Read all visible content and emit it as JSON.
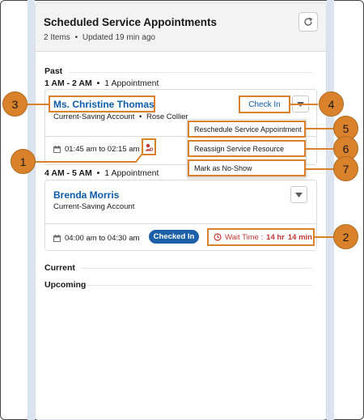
{
  "header": {
    "title": "Scheduled Service Appointments",
    "item_count": "2 Items",
    "separator": "•",
    "updated": "Updated 19 min ago"
  },
  "sections": {
    "past": "Past",
    "current": "Current",
    "upcoming": "Upcoming"
  },
  "slots": [
    {
      "range": "1 AM - 2 AM",
      "bullet": "•",
      "count": "1 Appointment",
      "appointment": {
        "customer": "Ms. Christine Thomas",
        "account": "Current-Saving Account",
        "bullet": "•",
        "resource": "Rose Collier",
        "time": "01:45 am to 02:15 am",
        "action": "Check In"
      }
    },
    {
      "range": "4 AM - 5 AM",
      "bullet": "•",
      "count": "1 Appointment",
      "appointment": {
        "customer": "Brenda Morris",
        "account": "Current-Saving Account",
        "time": "04:00 am to 04:30 am",
        "status": "Checked In",
        "wait_label": "Wait Time :",
        "wait_hours": "14 hr",
        "wait_minutes": "14 min"
      }
    }
  ],
  "menu": {
    "items": [
      "Reschedule Service Appointment",
      "Reassign Service Resource",
      "Mark as No-Show"
    ]
  },
  "callouts": [
    "1",
    "2",
    "3",
    "4",
    "5",
    "6",
    "7"
  ],
  "icons": {
    "refresh": "refresh-icon",
    "calendar": "calendar-icon",
    "resource": "service-resource-icon",
    "dropdown": "chevron-down-icon",
    "clock": "clock-icon"
  },
  "colors": {
    "accent": "#d9822b",
    "link": "#0b5cab",
    "badge": "#1b5fa8",
    "wait": "#c23934",
    "header_bg": "#f3f3f3"
  }
}
